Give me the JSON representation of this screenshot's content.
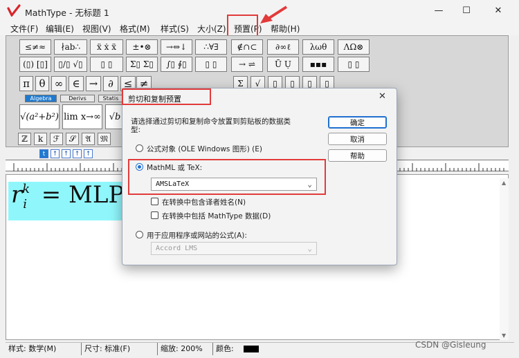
{
  "window": {
    "title": "MathType - 无标题 1",
    "minimize": "—",
    "maximize": "☐",
    "close": "✕"
  },
  "menu": {
    "items": [
      "文件(F)",
      "编辑(E)",
      "视图(V)",
      "格式(M)",
      "样式(S)",
      "大小(Z)",
      "预置(P)",
      "帮助(H)"
    ]
  },
  "palette": {
    "row1": [
      "≤≠≈",
      "∤ab∴",
      "ẍ ẋ ẍ",
      "±•⊗",
      "→⇔↓",
      "∴∀∃",
      "∉∩⊂",
      "∂∞ℓ",
      "λωθ",
      "ΛΩ⊗"
    ],
    "row2": [
      "(▯) [▯]",
      "▯/▯ √▯",
      "▯ ▯",
      "Σ▯ Σ▯",
      "∫▯ ∮▯",
      "▯ ▯",
      "→ ⇌",
      "Ū Ụ",
      "▪▪▪",
      "▯ ▯"
    ],
    "row3": [
      "π",
      "θ",
      "∞",
      "∈",
      "→",
      "∂",
      "≤",
      "≠"
    ],
    "tabs": [
      "Algebra",
      "Derivs",
      "Statis"
    ],
    "templates": [
      "√(a²+b²)",
      "lim x→∞",
      "√b"
    ],
    "row5": [
      "ℤ",
      "k",
      "ℱ",
      "𝒮",
      "𝔄",
      "𝔐"
    ],
    "size_icons": [
      "t",
      "↑",
      "↑",
      "↑",
      "↑"
    ]
  },
  "editor": {
    "formula": "r_i^k = MLP(",
    "formula_display_base": "r",
    "formula_sup": "k",
    "formula_sub": "i",
    "formula_rest": "= MLP("
  },
  "status": {
    "style": "样式: 数学(M)",
    "size": "尺寸: 标准(F)",
    "zoom": "缩放: 200%",
    "color": "颜色:",
    "color_swatch": "#000000"
  },
  "dialog": {
    "title": "剪切和复制预置",
    "close": "✕",
    "description": "请选择通过剪切和复制命令放置到剪贴板的数据类型:",
    "description_line1": "请选择通过剪切和复制命令放置到剪贴板的数据类",
    "description_line2": "型:",
    "option_ole": "公式对象 (OLE Windows 图形) (E)",
    "option_mathml": "MathML 或 TeX:",
    "mathml_value": "AMSLaTeX",
    "check_translator": "在转换中包含译者姓名(N)",
    "check_mathtype": "在转换中包括 MathType 数据(D)",
    "option_app": "用于应用程序或网站的公式(A):",
    "app_value": "Accord LMS",
    "btn_ok": "确定",
    "btn_cancel": "取消",
    "btn_help": "帮助",
    "selected_option": "mathml"
  },
  "watermark": "CSDN @Gisleung",
  "colors": {
    "highlight": "#e23a3a",
    "formula_bg": "#8ff7fb",
    "accent": "#1f6fd0"
  }
}
